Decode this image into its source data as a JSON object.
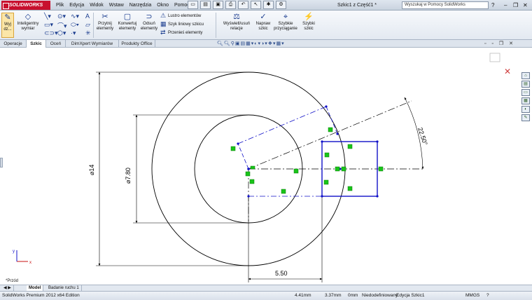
{
  "app": {
    "logo": "SOLIDWORKS",
    "doc_title": "Szkic1 z Część1 *"
  },
  "menu": [
    "Plik",
    "Edycja",
    "Widok",
    "Wstaw",
    "Narzędzia",
    "Okno",
    "Pomoc"
  ],
  "search": {
    "placeholder": "Wyszukaj w Pomocy SolidWorks"
  },
  "ribbon": {
    "exit_sketch": "Wyj dz...",
    "smart_dim": "Inteligentny wymiar",
    "offset": "Przytnij elementy",
    "convert": "Konwertuj elementy",
    "offset_ent": "Odsuń elementy",
    "mirror": "Lustro elementów",
    "linear_pattern": "Szyk liniowy szkicu",
    "move": "Przenieś elementy",
    "relations": "Wyświetl/usuń relacje",
    "repair": "Napraw szkic",
    "quick_snaps": "Szybkie przyciąganie",
    "rapid_sketch": "Szybki szkic"
  },
  "tabs": [
    "Operacje",
    "Szkic",
    "Oceń",
    "DimXpert Wymiarów",
    "Produkty Office"
  ],
  "active_tab": "Szkic",
  "drawing": {
    "dims": {
      "d14": "⌀14",
      "d780": "⌀7.80",
      "len": "5.50",
      "angle": "22.50°"
    }
  },
  "footnote": "*Przód",
  "bottom_tabs": [
    "Model",
    "Badanie ruchu 1"
  ],
  "status": {
    "edition": "SolidWorks Premium 2012 x64 Edition",
    "x": "4.41mm",
    "y": "3.37mm",
    "z": "0mm",
    "state": "Niedodefiniowany",
    "mode": "Edycja Szkic1",
    "units": "MMGS"
  },
  "colors": {
    "sketch_blue": "#1010c8",
    "relation_green": "#19c419",
    "dim_black": "#000000"
  }
}
